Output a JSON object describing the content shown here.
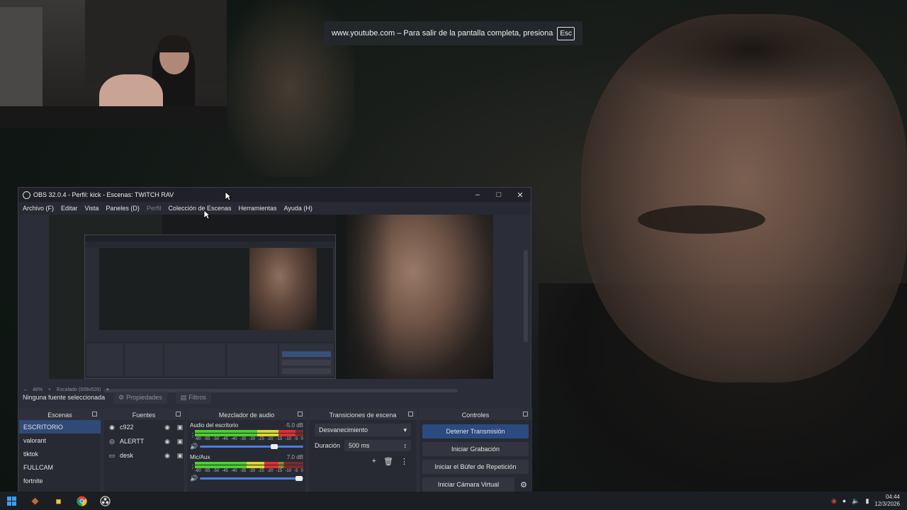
{
  "fullscreen_notice": {
    "text": "www.youtube.com – Para salir de la pantalla completa, presiona",
    "key": "Esc"
  },
  "obs": {
    "title": "OBS 32.0.4 - Perfil: kick - Escenas: TWITCH RAV",
    "menu": [
      {
        "label": "Archivo (F)",
        "enabled": true
      },
      {
        "label": "Editar",
        "enabled": true
      },
      {
        "label": "Vista",
        "enabled": true
      },
      {
        "label": "Paneles (D)",
        "enabled": true
      },
      {
        "label": "Perfil",
        "enabled": false
      },
      {
        "label": "Colección de Escenas",
        "enabled": true
      },
      {
        "label": "Herramientas",
        "enabled": true
      },
      {
        "label": "Ayuda (H)",
        "enabled": true
      }
    ],
    "preview_status": {
      "zoom": "48%",
      "scaling": "Escalado (939x528)"
    },
    "source_toolbar": {
      "no_source": "Ninguna fuente seleccionada",
      "properties": "Propiedades",
      "filters": "Filtros"
    },
    "scenes": {
      "title": "Escenas",
      "items": [
        "ESCRITORIO",
        "valorant",
        "tiktok",
        "FULLCAM",
        "fortnite"
      ],
      "active_index": 0
    },
    "sources": {
      "title": "Fuentes",
      "items": [
        {
          "name": "c922",
          "icon": "camera-icon"
        },
        {
          "name": "ALERTT",
          "icon": "browser-icon"
        },
        {
          "name": "desk",
          "icon": "display-icon"
        }
      ]
    },
    "mixer": {
      "title": "Mezclador de audio",
      "ticks": [
        "-60",
        "-55",
        "-50",
        "-45",
        "-40",
        "-35",
        "-30",
        "-25",
        "-20",
        "-15",
        "-10",
        "-5",
        "0"
      ],
      "channels": [
        {
          "name": "Audio del escritorio",
          "db": "-5.0 dB",
          "level": 0.93,
          "volume": 0.72
        },
        {
          "name": "Mic/Aux",
          "db": "7.0 dB",
          "level": 0.77,
          "volume": 0.96
        }
      ]
    },
    "transitions": {
      "title": "Transiciones de escena",
      "selected": "Desvanecimiento",
      "duration_label": "Duración",
      "duration_value": "500 ms"
    },
    "controls": {
      "title": "Controles",
      "stop_stream": "Detener Transmisión",
      "start_recording": "Iniciar Grabación",
      "replay_buffer": "Iniciar el Búfer de Repetición",
      "virtual_cam": "Iniciar Cámara Virtual"
    }
  },
  "taskbar": {
    "time": "04:44",
    "date": "12/3/2026"
  }
}
